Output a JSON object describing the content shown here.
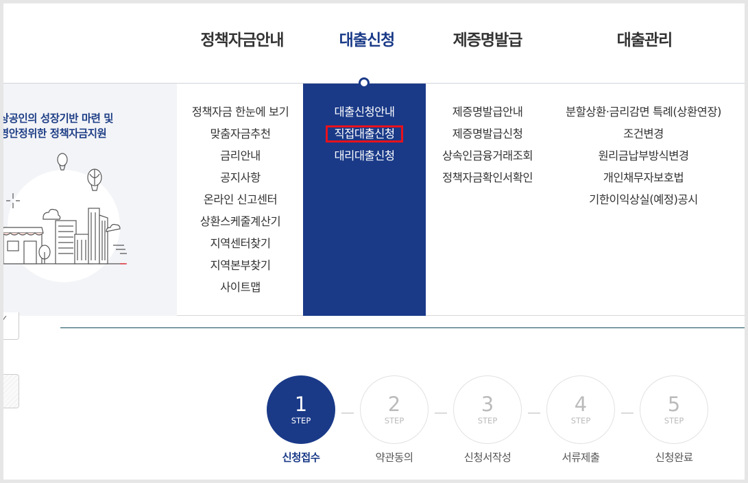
{
  "nav": {
    "items": [
      {
        "label": "정책자금안내",
        "active": false
      },
      {
        "label": "대출신청",
        "active": true
      },
      {
        "label": "제증명발급",
        "active": false
      },
      {
        "label": "대출관리",
        "active": false
      }
    ]
  },
  "promo": {
    "line1": "상공인의 성장기반 마련 및",
    "line2": "영안정위한 정책자금지원"
  },
  "menu": {
    "col1": [
      "정책자금 한눈에 보기",
      "맞춤자금추천",
      "금리안내",
      "공지사항",
      "온라인 신고센터",
      "상환스케줄계산기",
      "지역센터찾기",
      "지역본부찾기",
      "사이트맵"
    ],
    "col2": [
      "대출신청안내",
      "직접대출신청",
      "대리대출신청"
    ],
    "col2_highlighted_index": 1,
    "col3": [
      "제증명발급안내",
      "제증명발급신청",
      "상속인금융거래조회",
      "정책자금확인서확인"
    ],
    "col4": [
      "분할상환·금리감면 특례(상환연장)",
      "조건변경",
      "원리금납부방식변경",
      "개인채무자보호법",
      "기한이익상실(예정)공시"
    ]
  },
  "side": {
    "check_glyph": "✓"
  },
  "steps": {
    "sub_label": "STEP",
    "items": [
      {
        "num": "1",
        "label": "신청접수",
        "active": true
      },
      {
        "num": "2",
        "label": "약관동의",
        "active": false
      },
      {
        "num": "3",
        "label": "신청서작성",
        "active": false
      },
      {
        "num": "4",
        "label": "서류제출",
        "active": false
      },
      {
        "num": "5",
        "label": "신청완료",
        "active": false
      }
    ]
  },
  "colors": {
    "primary": "#1a3a88",
    "highlight": "#e8111b",
    "inactive_text": "#bbbbbb"
  }
}
